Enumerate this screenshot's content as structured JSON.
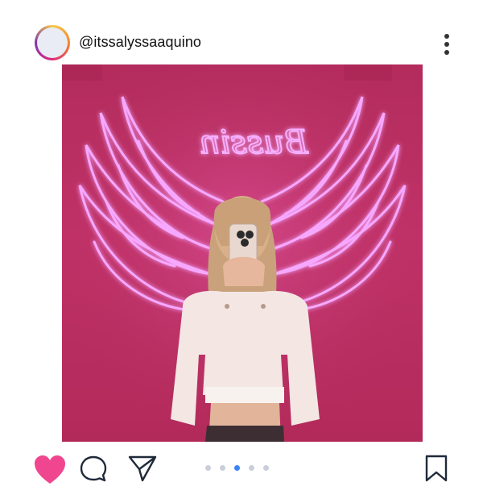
{
  "post": {
    "username": "@itssalyssaaquino",
    "photo": {
      "neon_sign_text": "Bussin",
      "neon_color": "#f08cff",
      "background_color": "#b8305f"
    }
  },
  "icons": {
    "more": "more-vertical-icon",
    "like": "heart-icon",
    "comment": "comment-bubble-icon",
    "share": "paper-plane-icon",
    "save": "bookmark-icon"
  },
  "colors": {
    "like_active": "#f0468f",
    "carousel_active": "#3a84f5",
    "carousel_inactive": "#c9ced8"
  },
  "carousel": {
    "count": 5,
    "active_index": 2
  }
}
